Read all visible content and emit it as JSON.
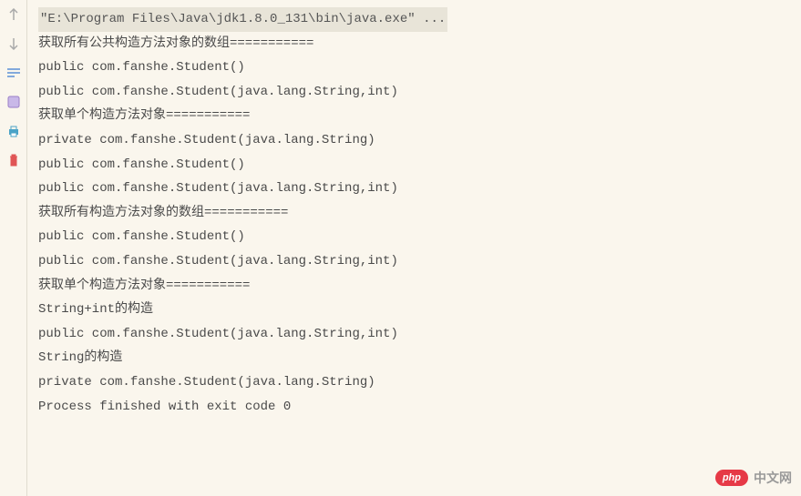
{
  "gutter": {
    "icons": [
      {
        "name": "arrow-up-icon"
      },
      {
        "name": "arrow-down-icon"
      },
      {
        "name": "soft-wrap-icon"
      },
      {
        "name": "scroll-to-end-icon"
      },
      {
        "name": "print-icon"
      },
      {
        "name": "clear-icon"
      }
    ]
  },
  "console": {
    "command": "\"E:\\Program Files\\Java\\jdk1.8.0_131\\bin\\java.exe\" ...",
    "lines": [
      "获取所有公共构造方法对象的数组===========",
      "public com.fanshe.Student()",
      "public com.fanshe.Student(java.lang.String,int)",
      "获取单个构造方法对象===========",
      "private com.fanshe.Student(java.lang.String)",
      "public com.fanshe.Student()",
      "public com.fanshe.Student(java.lang.String,int)",
      "获取所有构造方法对象的数组===========",
      "public com.fanshe.Student()",
      "public com.fanshe.Student(java.lang.String,int)",
      "获取单个构造方法对象===========",
      "String+int的构造",
      "public com.fanshe.Student(java.lang.String,int)",
      "String的构造",
      "private com.fanshe.Student(java.lang.String)",
      "",
      "Process finished with exit code 0"
    ]
  },
  "watermark": {
    "badge": "php",
    "text": "中文网"
  }
}
